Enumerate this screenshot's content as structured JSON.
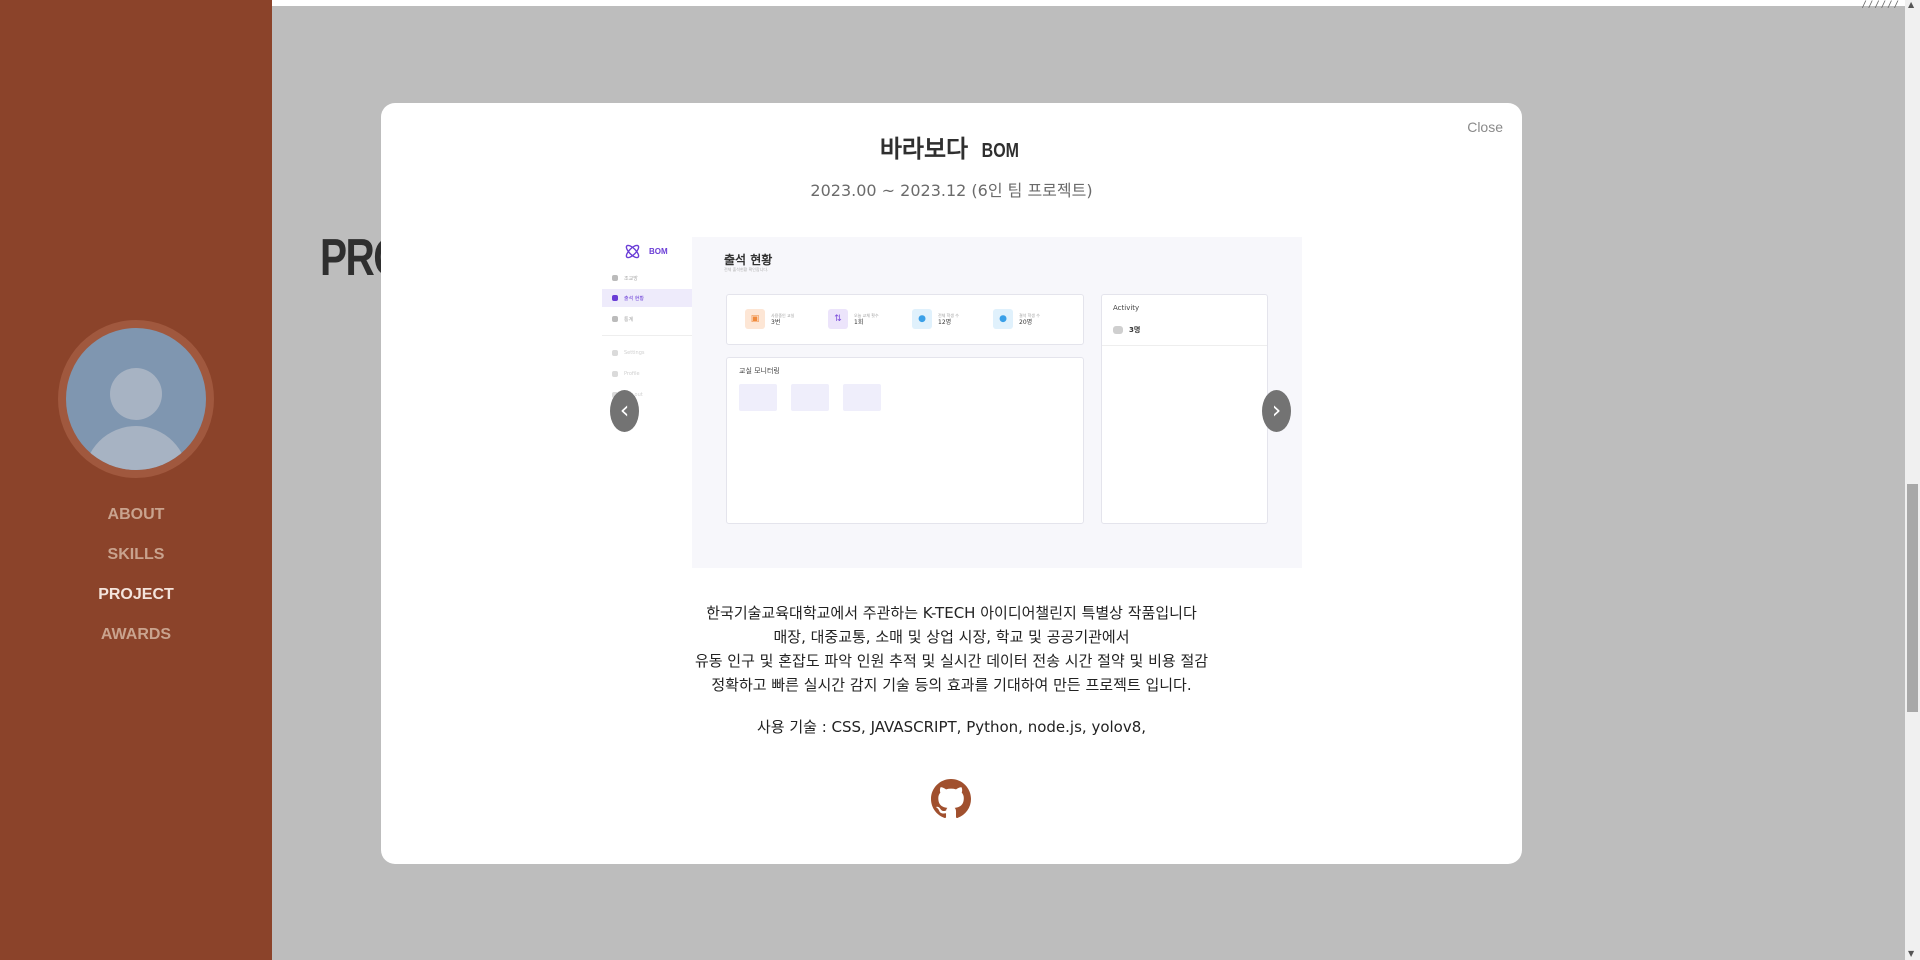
{
  "sidebar": {
    "nav": [
      {
        "label": "ABOUT",
        "active": false
      },
      {
        "label": "SKILLS",
        "active": false
      },
      {
        "label": "PROJECT",
        "active": true
      },
      {
        "label": "AWARDS",
        "active": false
      }
    ]
  },
  "page": {
    "title_partial": "PRO",
    "corner_mark": "∕∕∕∕∕∕"
  },
  "modal": {
    "close_label": "Close",
    "title_ko": "바라보다",
    "title_en": "BOM",
    "date": "2023.00 ~ 2023.12 (6인 팀 프로젝트)",
    "prev_label": "‹",
    "next_label": "›",
    "screenshot": {
      "logo_text": "BOM",
      "nav": [
        "조교방",
        "출석 현황",
        "통계",
        "Settings",
        "Profile",
        "Log out"
      ],
      "heading": "출석 현황",
      "subheading": "전체 출석현황 확인합니다.",
      "stats": [
        {
          "label": "사용중인 교실",
          "value": "3번",
          "color": "#f08a3c"
        },
        {
          "label": "오늘 교체 횟수",
          "value": "1회",
          "color": "#7c4ddb"
        },
        {
          "label": "전체 학생 수",
          "value": "12명",
          "color": "#3aa0e8"
        },
        {
          "label": "결석 학생 수",
          "value": "20명",
          "color": "#3aa0e8"
        }
      ],
      "monitor_title": "교실 모니터링",
      "activity_title": "Activity",
      "activity_value": "3명"
    },
    "description": [
      "한국기술교육대학교에서 주관하는 K-TECH 아이디어챌린지 특별상 작품입니다",
      "매장, 대중교통, 소매 및 상업 시장, 학교 및 공공기관에서",
      "유동 인구 및 혼잡도 파악 인원 추적 및 실시간 데이터 전송 시간 절약 및 비용 절감",
      "정확하고 빠른 실시간 감지 기술 등의 효과를 기대하여 만든 프로젝트 입니다."
    ],
    "tech": "사용 기술 : CSS, JAVASCRIPT, Python, node.js, yolov8,",
    "github_icon": "github-icon",
    "github_color": "#a0502e"
  }
}
